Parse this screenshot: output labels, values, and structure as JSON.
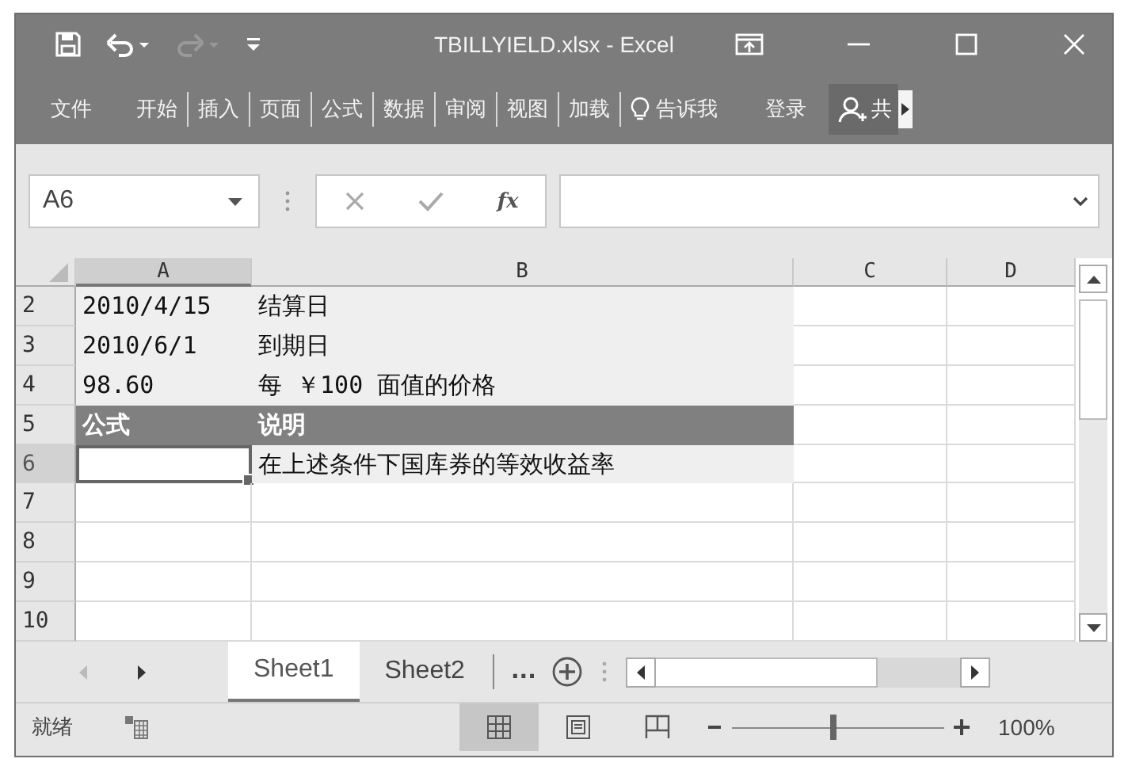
{
  "window": {
    "title": "TBILLYIELD.xlsx - Excel"
  },
  "ribbon": {
    "tabs": [
      {
        "label": "文件"
      },
      {
        "label": "开始"
      },
      {
        "label": "插入"
      },
      {
        "label": "页面"
      },
      {
        "label": "公式"
      },
      {
        "label": "数据"
      },
      {
        "label": "审阅"
      },
      {
        "label": "视图"
      },
      {
        "label": "加载"
      }
    ],
    "tell_me": "告诉我",
    "sign_in": "登录",
    "share": "共"
  },
  "formula_bar": {
    "name_box": "A6",
    "fx": "fx"
  },
  "columns": [
    {
      "label": "A",
      "selected": true
    },
    {
      "label": "B",
      "selected": false
    },
    {
      "label": "C",
      "selected": false
    },
    {
      "label": "D",
      "selected": false
    }
  ],
  "rows": [
    {
      "number": "2",
      "selected": false,
      "cells": [
        {
          "text": "2010/4/15",
          "kind": "data"
        },
        {
          "text": "结算日",
          "kind": "data"
        }
      ]
    },
    {
      "number": "3",
      "selected": false,
      "cells": [
        {
          "text": "2010/6/1",
          "kind": "data"
        },
        {
          "text": "到期日",
          "kind": "data"
        }
      ]
    },
    {
      "number": "4",
      "selected": false,
      "cells": [
        {
          "text": "98.60",
          "kind": "data"
        },
        {
          "text": "每 ￥100 面值的价格",
          "kind": "data"
        }
      ]
    },
    {
      "number": "5",
      "selected": false,
      "cells": [
        {
          "text": "公式",
          "kind": "header"
        },
        {
          "text": "说明",
          "kind": "header"
        }
      ]
    },
    {
      "number": "6",
      "selected": true,
      "cells": [
        {
          "kind": "data",
          "selected": true
        },
        {
          "text": "在上述条件下国库券的等效收益率",
          "kind": "data"
        }
      ]
    },
    {
      "number": "7",
      "selected": false
    },
    {
      "number": "8",
      "selected": false
    },
    {
      "number": "9",
      "selected": false
    },
    {
      "number": "10",
      "selected": false
    }
  ],
  "sheet_tabs": [
    {
      "label": "Sheet1",
      "selected": true
    },
    {
      "label": "Sheet2",
      "selected": false
    }
  ],
  "more_sheets": "...",
  "status_bar": {
    "status": "就绪",
    "views": [
      {
        "kind": "normal",
        "selected": true
      },
      {
        "kind": "page_layout",
        "selected": false
      },
      {
        "kind": "page_break",
        "selected": false
      }
    ],
    "zoom": {
      "level": 0.48
    },
    "zoom_text": "100%"
  }
}
